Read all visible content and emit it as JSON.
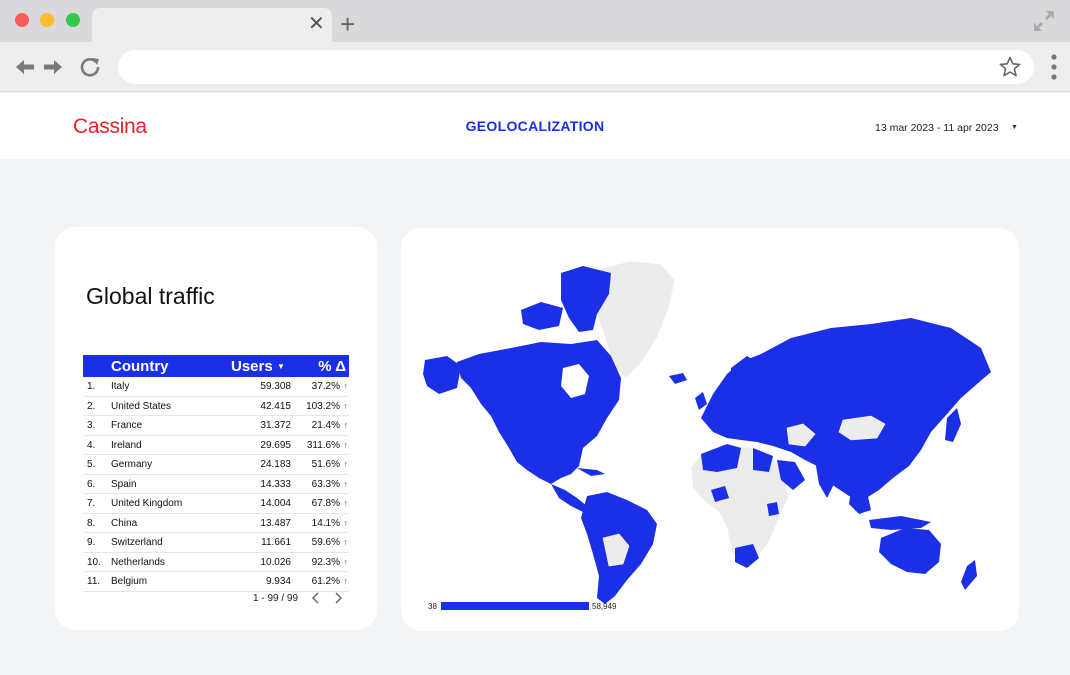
{
  "page": {
    "logo": "Cassina",
    "title": "GEOLOCALIZATION",
    "date_range": "13 mar 2023 - 11 apr 2023"
  },
  "traffic": {
    "title": "Global traffic",
    "headers": {
      "country": "Country",
      "users": "Users",
      "delta": "% Δ"
    },
    "rows": [
      {
        "idx": "1.",
        "country": "Italy",
        "users": "59.308",
        "delta": "37.2%"
      },
      {
        "idx": "2.",
        "country": "United States",
        "users": "42.415",
        "delta": "103.2%"
      },
      {
        "idx": "3.",
        "country": "France",
        "users": "31.372",
        "delta": "21.4%"
      },
      {
        "idx": "4.",
        "country": "Ireland",
        "users": "29.695",
        "delta": "311.6%"
      },
      {
        "idx": "5.",
        "country": "Germany",
        "users": "24.183",
        "delta": "51.6%"
      },
      {
        "idx": "6.",
        "country": "Spain",
        "users": "14.333",
        "delta": "63.3%"
      },
      {
        "idx": "7.",
        "country": "United Kingdom",
        "users": "14.004",
        "delta": "67.8%"
      },
      {
        "idx": "8.",
        "country": "China",
        "users": "13.487",
        "delta": "14.1%"
      },
      {
        "idx": "9.",
        "country": "Switzerland",
        "users": "11.661",
        "delta": "59.6%"
      },
      {
        "idx": "10.",
        "country": "Netherlands",
        "users": "10.026",
        "delta": "92.3%"
      },
      {
        "idx": "11.",
        "country": "Belgium",
        "users": "9.934",
        "delta": "61.2%"
      }
    ],
    "pager": "1 - 99 / 99"
  },
  "map": {
    "legend_min": "38",
    "legend_max": "58,949"
  },
  "colors": {
    "accent": "#1a2fe6",
    "brand": "#e3232f",
    "positive": "#1e8e3e",
    "map_empty": "#ececec"
  },
  "icons": [
    "back-arrow-icon",
    "forward-arrow-icon",
    "reload-icon",
    "star-icon",
    "kebab-menu-icon",
    "close-icon",
    "plus-icon",
    "expand-icon",
    "chevron-left-icon",
    "chevron-right-icon",
    "sort-down-icon",
    "trend-up-icon"
  ]
}
